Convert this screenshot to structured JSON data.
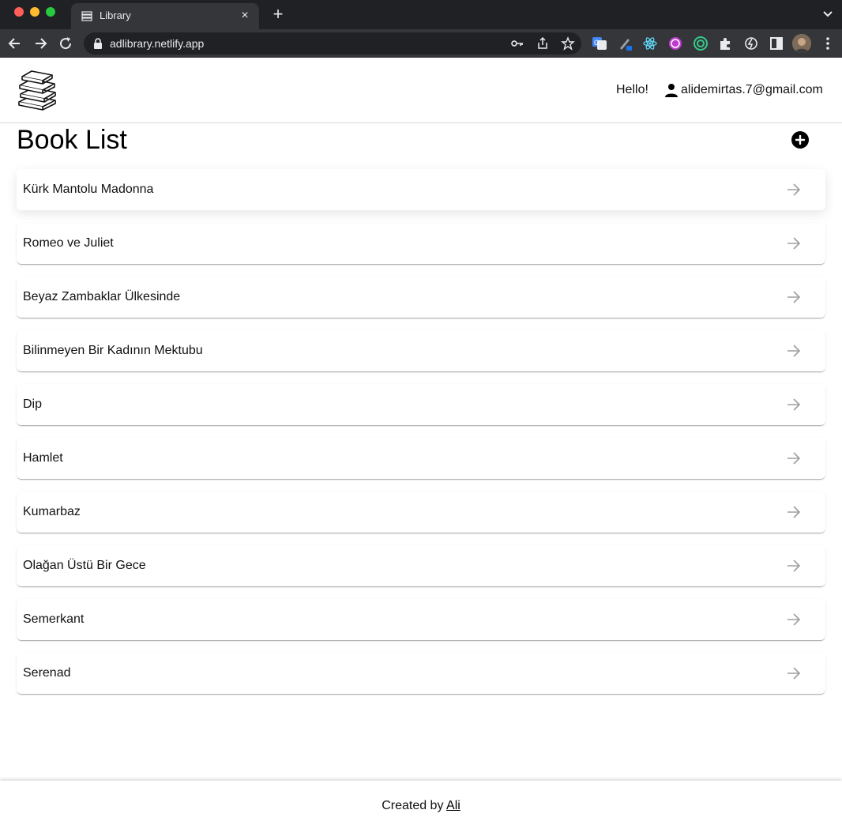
{
  "browser": {
    "tab_title": "Library",
    "tab_close": "×",
    "new_tab": "+",
    "url": "adlibrary.netlify.app"
  },
  "header": {
    "greeting": "Hello!",
    "user_email": "alidemirtas.7@gmail.com"
  },
  "main": {
    "title": "Book List",
    "books": [
      "Kürk Mantolu Madonna",
      "Romeo ve Juliet",
      "Beyaz Zambaklar Ülkesinde",
      "Bilinmeyen Bir Kadının Mektubu",
      "Dip",
      "Hamlet",
      "Kumarbaz",
      "Olağan Üstü Bir Gece",
      "Semerkant",
      "Serenad"
    ]
  },
  "footer": {
    "prefix": "Created by",
    "author": "Ali"
  },
  "colors": {
    "tab_bar": "#202124",
    "toolbar": "#35363a",
    "arrow": "#9e9e9e",
    "accent": "#000000"
  }
}
